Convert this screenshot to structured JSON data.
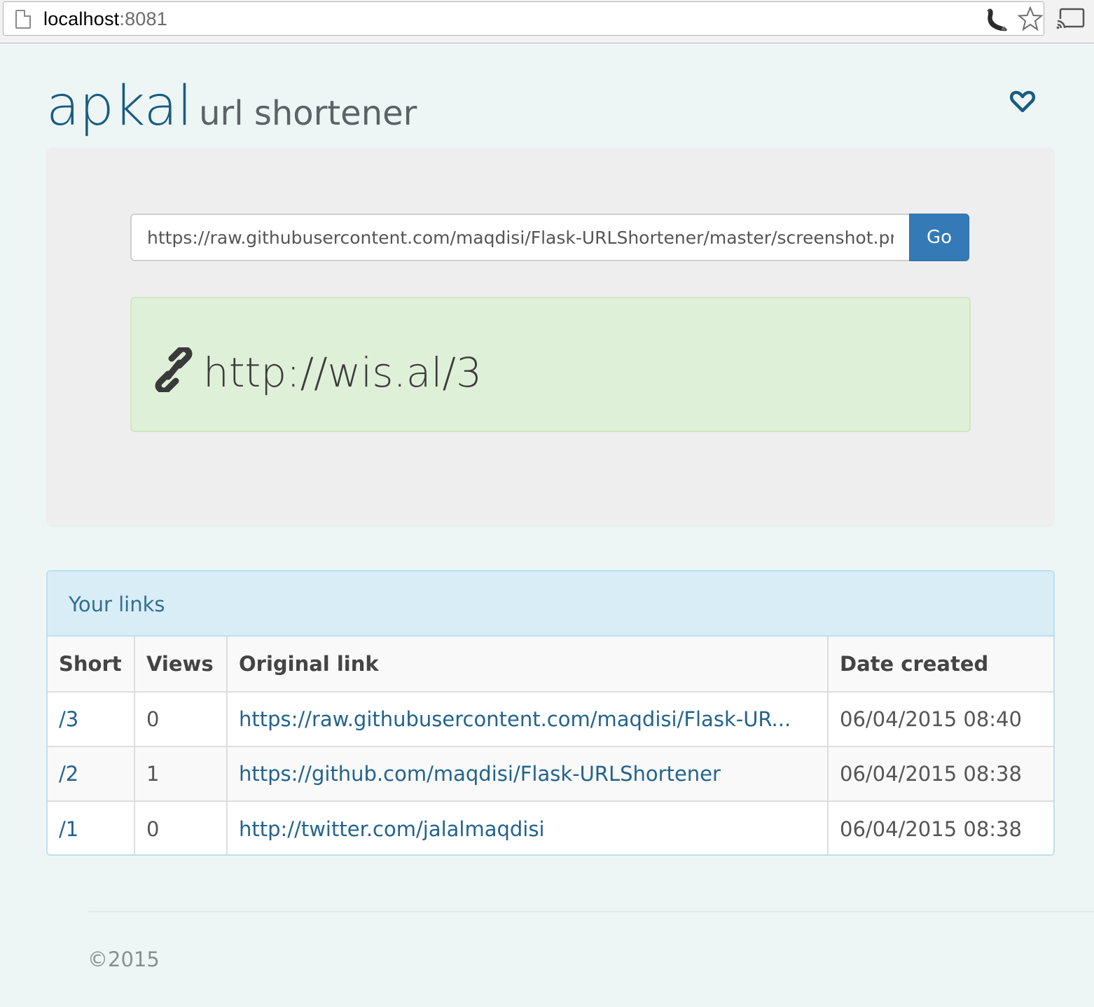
{
  "browser": {
    "url_host": "localhost",
    "url_port": ":8081"
  },
  "header": {
    "brand_main": "apkal",
    "brand_sub": "url shortener"
  },
  "form": {
    "input_value": "https://raw.githubusercontent.com/maqdisi/Flask-URLShortener/master/screenshot.png",
    "go_label": "Go"
  },
  "result": {
    "short_url": "http://wis.al/3"
  },
  "links_panel": {
    "title": "Your links",
    "columns": [
      "Short",
      "Views",
      "Original link",
      "Date created"
    ],
    "rows": [
      {
        "short": "/3",
        "views": "0",
        "original": "https://raw.githubusercontent.com/maqdisi/Flask-UR...",
        "date": "06/04/2015 08:40"
      },
      {
        "short": "/2",
        "views": "1",
        "original": "https://github.com/maqdisi/Flask-URLShortener",
        "date": "06/04/2015 08:38"
      },
      {
        "short": "/1",
        "views": "0",
        "original": "http://twitter.com/jalalmaqdisi",
        "date": "06/04/2015 08:38"
      }
    ]
  },
  "footer": {
    "copyright": "©2015"
  },
  "colors": {
    "brand": "#175c82",
    "go_button": "#337ab7",
    "result_bg": "#dff0d8",
    "panel_heading_bg": "#d9edf7",
    "link": "#23638e"
  },
  "icons": {
    "page": "page-icon",
    "extension": "extension-icon",
    "bookmark": "star-icon",
    "cast": "cast-icon",
    "favorite": "heart-icon",
    "link": "link-icon"
  }
}
